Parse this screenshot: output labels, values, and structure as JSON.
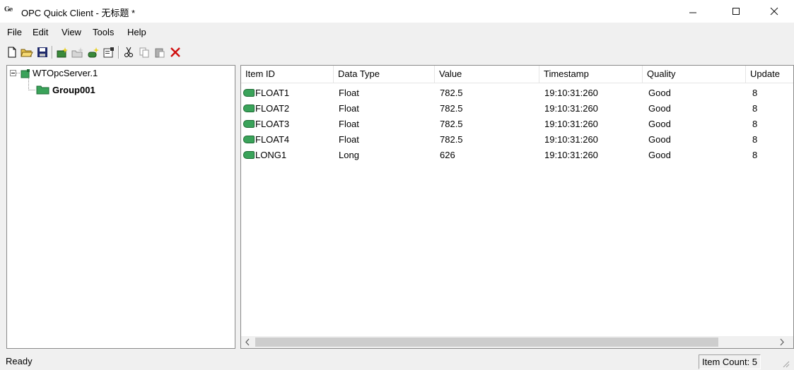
{
  "window": {
    "title": "OPC Quick Client - 无标题 *",
    "app_icon_text": "Ge"
  },
  "menu": [
    "File",
    "Edit",
    "View",
    "Tools",
    "Help"
  ],
  "toolbar": {
    "icons": [
      "new-file-icon",
      "open-folder-icon",
      "save-icon",
      "new-server-icon",
      "new-group-icon",
      "new-item-icon",
      "properties-icon",
      "cut-icon",
      "copy-icon",
      "paste-icon",
      "delete-icon"
    ]
  },
  "tree": {
    "server": "WTOpcServer.1",
    "group": "Group001"
  },
  "list": {
    "columns": [
      "Item ID",
      "Data Type",
      "Value",
      "Timestamp",
      "Quality",
      "Update"
    ],
    "rows": [
      {
        "id": "FLOAT1",
        "type": "Float",
        "value": "782.5",
        "timestamp": "19:10:31:260",
        "quality": "Good",
        "update": "8"
      },
      {
        "id": "FLOAT2",
        "type": "Float",
        "value": "782.5",
        "timestamp": "19:10:31:260",
        "quality": "Good",
        "update": "8"
      },
      {
        "id": "FLOAT3",
        "type": "Float",
        "value": "782.5",
        "timestamp": "19:10:31:260",
        "quality": "Good",
        "update": "8"
      },
      {
        "id": "FLOAT4",
        "type": "Float",
        "value": "782.5",
        "timestamp": "19:10:31:260",
        "quality": "Good",
        "update": "8"
      },
      {
        "id": "LONG1",
        "type": "Long",
        "value": "626",
        "timestamp": "19:10:31:260",
        "quality": "Good",
        "update": "8"
      }
    ]
  },
  "status": {
    "text": "Ready",
    "count": "Item Count: 5"
  },
  "colors": {
    "tag_green": "#3aa35a"
  }
}
